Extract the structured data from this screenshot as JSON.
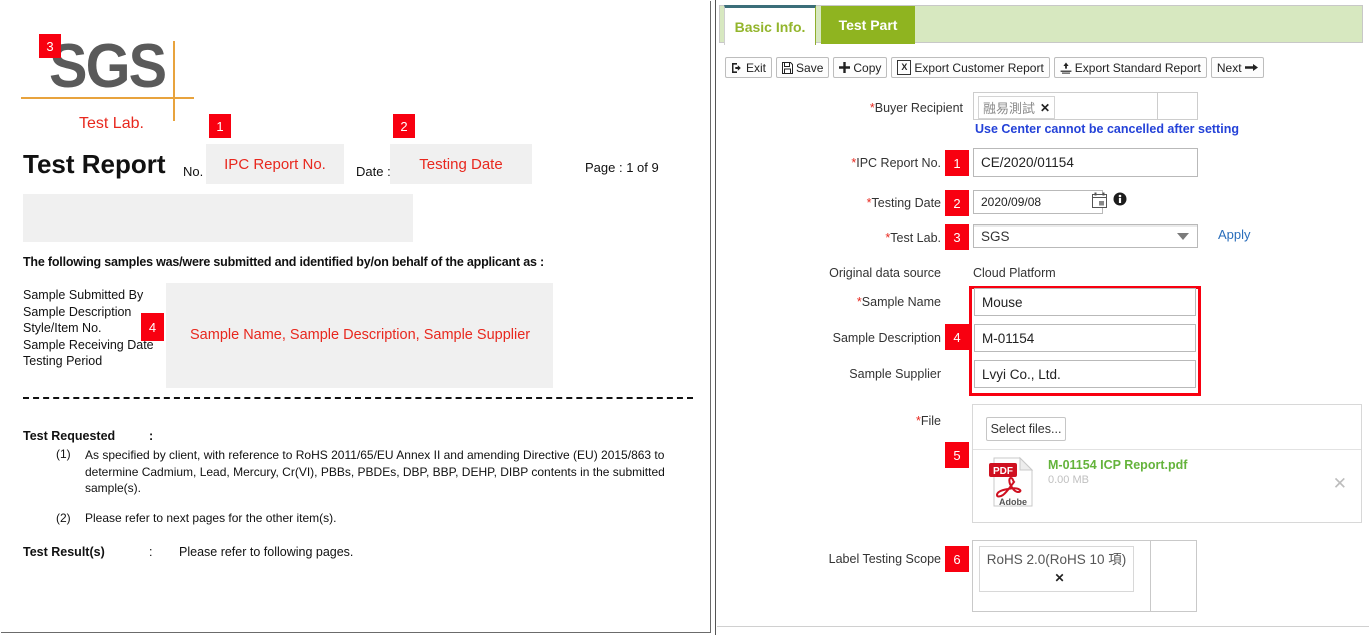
{
  "document": {
    "logo": {
      "brand": "SGS",
      "sub": "Test Lab."
    },
    "title": "Test Report",
    "no_label": "No.",
    "no_placeholder": "IPC Report No.",
    "date_label": "Date :",
    "date_placeholder": "Testing Date",
    "page_info": "Page : 1 of 9",
    "lead_text": "The following samples was/were submitted and identified by/on behalf of the applicant as :",
    "field_labels": [
      "Sample Submitted By",
      "Sample Description",
      "Style/Item No.",
      "Sample Receiving Date",
      "Testing Period"
    ],
    "sample_placeholder": "Sample Name, Sample Description, Sample Supplier",
    "test_requested_label": "Test Requested",
    "colon": ":",
    "item1_num": "(1)",
    "item1_text": "As specified by client, with reference to RoHS 2011/65/EU Annex II and amending Directive (EU) 2015/863 to determine Cadmium, Lead, Mercury, Cr(VI), PBBs, PBDEs, DBP, BBP, DEHP, DIBP contents in the submitted sample(s).",
    "item2_num": "(2)",
    "item2_text": "Please refer to next pages for the other item(s).",
    "test_results_label": "Test Result(s)",
    "test_results_value": "Please refer to following pages.",
    "badges": {
      "b1": "1",
      "b2": "2",
      "b3": "3",
      "b4": "4"
    }
  },
  "app": {
    "tabs": [
      {
        "label": "Basic Info.",
        "active": true
      },
      {
        "label": "Test Part",
        "active": false
      }
    ],
    "toolbar": [
      {
        "label": "Exit",
        "icon": "exit-icon"
      },
      {
        "label": "Save",
        "icon": "floppy-disk-icon"
      },
      {
        "label": "Copy",
        "icon": "plus-icon"
      },
      {
        "label": "Export Customer Report",
        "icon": "excel-icon"
      },
      {
        "label": "Export Standard Report",
        "icon": "download-icon"
      },
      {
        "label": "Next",
        "icon": "arrow-right-icon"
      }
    ],
    "form": {
      "buyer_recipient_label": "Buyer Recipient",
      "buyer_recipient_chip": "融易測試",
      "buyer_recipient_hint": "Use Center cannot be cancelled after setting",
      "ipc_report_no_label": "IPC Report No.",
      "ipc_report_no_value": "CE/2020/01154",
      "testing_date_label": "Testing Date",
      "testing_date_value": "2020/09/08",
      "test_lab_label": "Test Lab.",
      "test_lab_value": "SGS",
      "apply_link": "Apply",
      "original_source_label": "Original data source",
      "original_source_value": "Cloud Platform",
      "sample_name_label": "Sample Name",
      "sample_name_value": "Mouse",
      "sample_desc_label": "Sample Description",
      "sample_desc_value": "M-01154",
      "sample_supplier_label": "Sample Supplier",
      "sample_supplier_value": "Lvyi Co., Ltd.",
      "file_label": "File",
      "select_files_button": "Select files...",
      "file_name": "M-01154 ICP Report.pdf",
      "file_size": "0.00 MB",
      "file_type_badge": "PDF",
      "file_brand": "Adobe",
      "label_scope_label": "Label Testing Scope",
      "label_scope_chip": "RoHS 2.0(RoHS 10 項)",
      "badges": {
        "b1": "1",
        "b2": "2",
        "b3": "3",
        "b4": "4",
        "b5": "5",
        "b6": "6"
      }
    },
    "colors": {
      "tab_active_text": "#93b52c",
      "tab_inactive_bg": "#8fb420",
      "tabstrip_bg": "#d7e8c0",
      "badge_red": "#f80010",
      "link_blue": "#2442d8",
      "file_green": "#64b33b"
    }
  }
}
